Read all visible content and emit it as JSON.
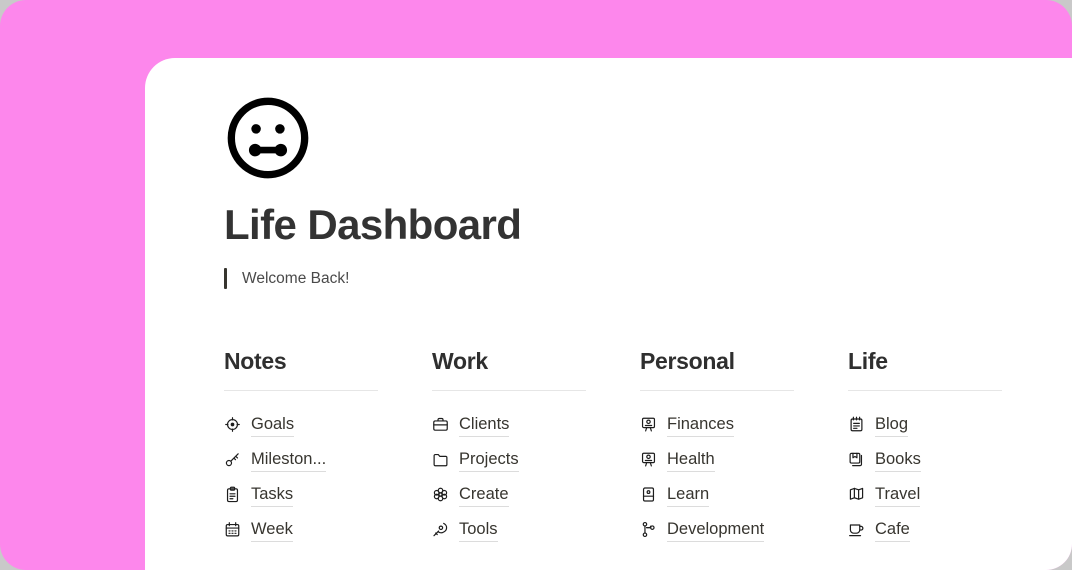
{
  "theme": {
    "page_backdrop": "#c9c9c9",
    "panel_pink": "#fd87ec",
    "card_white": "#ffffff",
    "title_color": "#333333",
    "text_color": "#37352f",
    "divider_color": "#e6e6e6",
    "underline_color": "#dcdcdc"
  },
  "header": {
    "avatar_icon": "face-with-bone-mouth-icon",
    "title": "Life Dashboard",
    "callout": "Welcome Back!"
  },
  "columns": [
    {
      "id": "notes",
      "title": "Notes",
      "links": [
        {
          "label": "Goals",
          "icon": "target-icon"
        },
        {
          "label": "Mileston...",
          "icon": "key-icon"
        },
        {
          "label": "Tasks",
          "icon": "clipboard-icon"
        },
        {
          "label": "Week",
          "icon": "calendar-icon"
        }
      ]
    },
    {
      "id": "work",
      "title": "Work",
      "links": [
        {
          "label": "Clients",
          "icon": "briefcase-icon"
        },
        {
          "label": "Projects",
          "icon": "folder-icon"
        },
        {
          "label": "Create",
          "icon": "flower-icon"
        },
        {
          "label": "Tools",
          "icon": "paint-brush-icon"
        }
      ]
    },
    {
      "id": "personal",
      "title": "Personal",
      "links": [
        {
          "label": "Finances",
          "icon": "atm-icon"
        },
        {
          "label": "Health",
          "icon": "atm-icon"
        },
        {
          "label": "Learn",
          "icon": "book-closed-icon"
        },
        {
          "label": "Development",
          "icon": "git-branch-icon"
        }
      ]
    },
    {
      "id": "life",
      "title": "Life",
      "links": [
        {
          "label": "Blog",
          "icon": "notepad-icon"
        },
        {
          "label": "Books",
          "icon": "books-stack-icon"
        },
        {
          "label": "Travel",
          "icon": "open-book-icon"
        },
        {
          "label": "Cafe",
          "icon": "coffee-cup-icon"
        }
      ]
    }
  ]
}
